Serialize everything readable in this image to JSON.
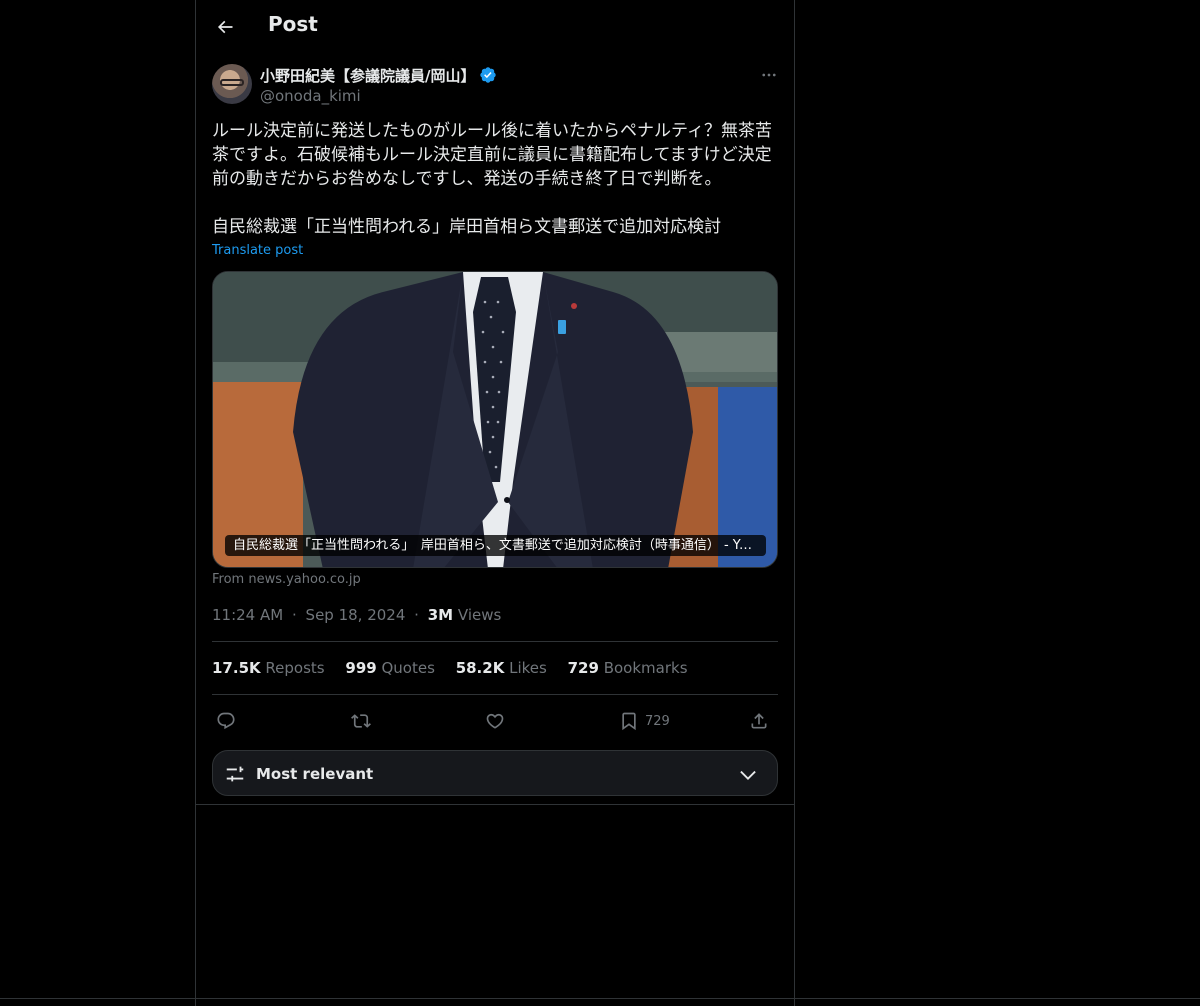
{
  "header": {
    "title": "Post"
  },
  "author": {
    "display_name": "小野田紀美【参議院議員/岡山】",
    "handle": "@onoda_kimi",
    "verified": true,
    "verified_color": "#1d9bf0"
  },
  "post": {
    "text": "ルール決定前に発送したものがルール後に着いたからペナルティ？無茶苦茶ですよ。石破候補もルール決定直前に議員に書籍配布してますけど決定前の動きだからお咎めなしですし、発送の手続き終了日で判断を。\n\n自民総裁選「正当性問われる」岸田首相ら文書郵送で追加対応検討",
    "translate_label": "Translate post"
  },
  "card": {
    "caption": "自民総裁選「正当性問われる」　岸田首相ら、文書郵送で追加対応検討（時事通信） - Yahoo!ニュース",
    "source": "From news.yahoo.co.jp"
  },
  "meta": {
    "time": "11:24 AM",
    "sep1": "·",
    "date": "Sep 18, 2024",
    "sep2": "·",
    "views_count": "3M",
    "views_label": "Views"
  },
  "stats": {
    "reposts": {
      "count": "17.5K",
      "label": "Reposts"
    },
    "quotes": {
      "count": "999",
      "label": "Quotes"
    },
    "likes": {
      "count": "58.2K",
      "label": "Likes"
    },
    "bookmarks": {
      "count": "729",
      "label": "Bookmarks"
    }
  },
  "actions": {
    "reply_icon": "reply-icon",
    "repost_icon": "repost-icon",
    "like_icon": "heart-icon",
    "bookmark_icon": "bookmark-icon",
    "bookmark_count": "729",
    "share_icon": "share-icon"
  },
  "sort": {
    "label": "Most relevant"
  },
  "colors": {
    "background": "#000000",
    "border": "#2f3336",
    "muted": "#71767b",
    "link": "#1d9bf0"
  }
}
